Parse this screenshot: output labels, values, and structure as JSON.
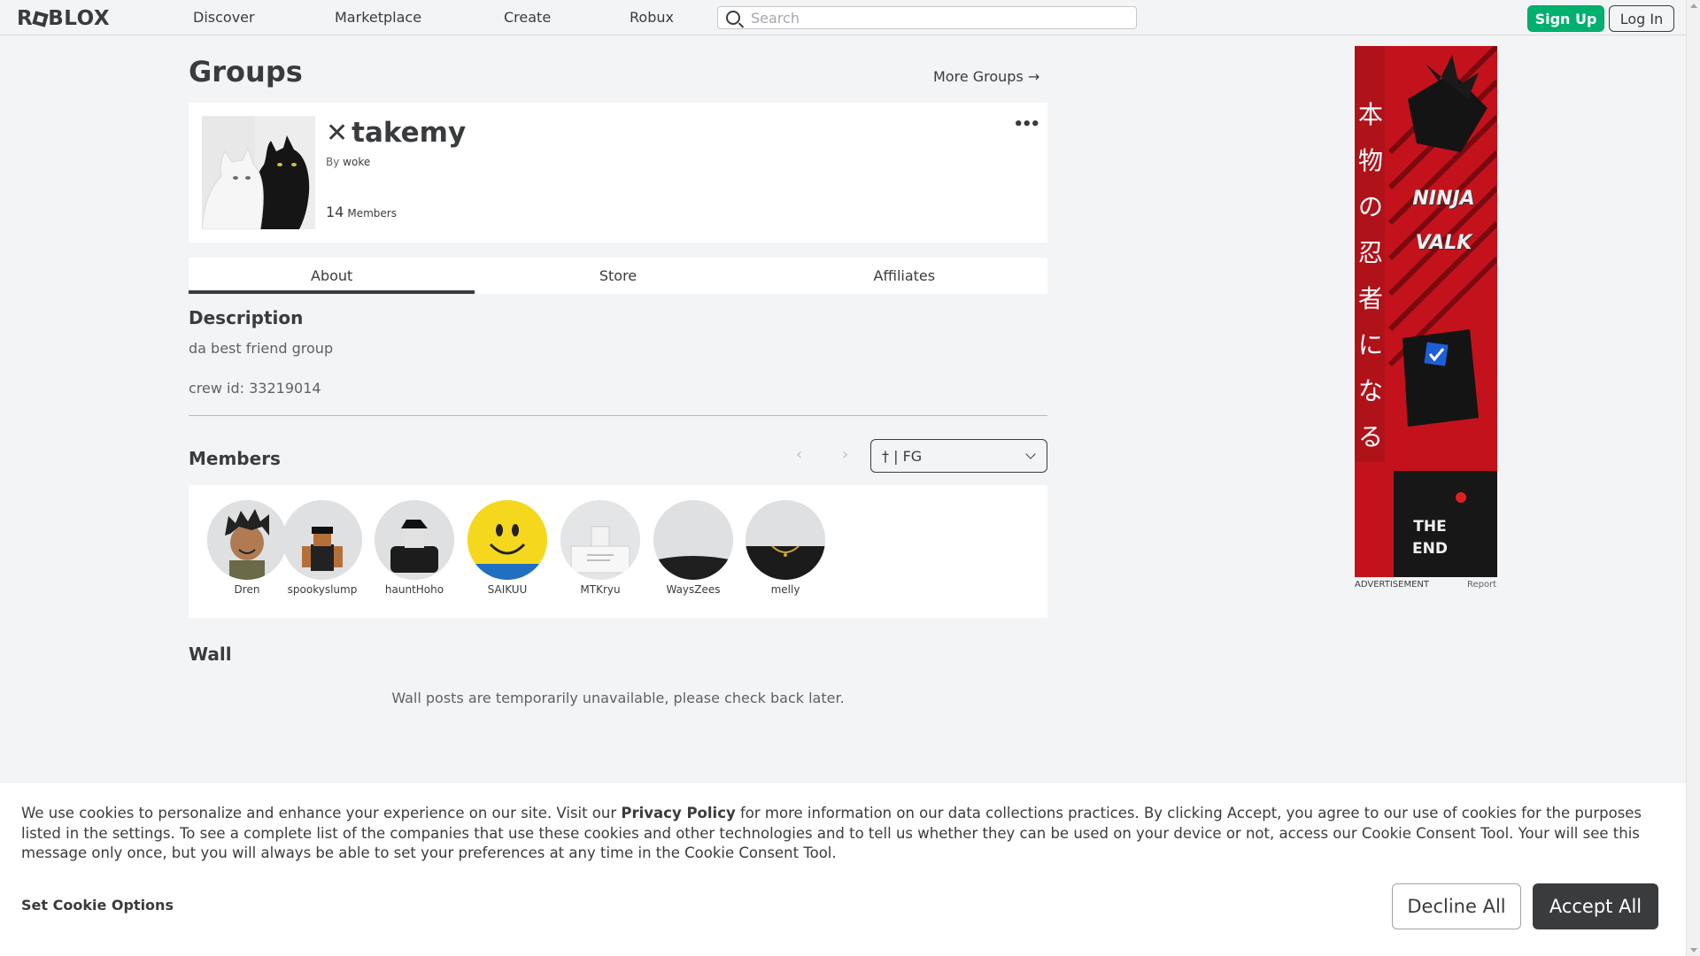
{
  "nav": {
    "logo": "ROBLOX",
    "links": [
      "Discover",
      "Marketplace",
      "Create",
      "Robux"
    ],
    "search_placeholder": "Search",
    "signup_label": "Sign Up",
    "login_label": "Log In"
  },
  "page": {
    "title": "Groups",
    "more_groups": "More Groups →"
  },
  "group": {
    "name": "takemy",
    "name_prefix_icon": "x-icon",
    "by_label": "By",
    "owner": "woke",
    "member_count": "14",
    "members_label": "Members",
    "more_options_icon": "ellipsis-icon"
  },
  "tabs": [
    {
      "label": "About",
      "active": true
    },
    {
      "label": "Store",
      "active": false
    },
    {
      "label": "Affiliates",
      "active": false
    }
  ],
  "about": {
    "description_heading": "Description",
    "description_lines": [
      "da best friend group",
      "crew id: 33219014"
    ]
  },
  "members_section": {
    "heading": "Members",
    "role_filter": "† | FG",
    "members": [
      {
        "name": "Dren"
      },
      {
        "name": "spookyslump"
      },
      {
        "name": "hauntHoho"
      },
      {
        "name": "SAIKUU"
      },
      {
        "name": "MTKryu"
      },
      {
        "name": "WaysZees"
      },
      {
        "name": "melly"
      }
    ]
  },
  "wall": {
    "heading": "Wall",
    "notice": "Wall posts are temporarily unavailable, please check back later."
  },
  "ad": {
    "label": "ADVERTISEMENT",
    "report": "Report",
    "vertical_text": "本物の忍者になる",
    "brand_text": [
      "NINJA",
      "VALK"
    ],
    "end_text": [
      "THE",
      "END"
    ]
  },
  "cookie": {
    "text_before": "We use cookies to personalize and enhance your experience on our site. Visit our ",
    "privacy_link": "Privacy Policy",
    "text_after": " for more information on our data collections practices. By clicking Accept, you agree to our use of cookies for the purposes listed in the settings. To see a complete list of the companies that use these cookies and other technologies and to tell us whether they can be used on your device or not, access our Cookie Consent Tool. Your will see this message only once, but you will always be able to set your preferences at any time in the Cookie Consent Tool.",
    "options_label": "Set Cookie Options",
    "decline_label": "Decline All",
    "accept_label": "Accept All"
  },
  "colors": {
    "accent_green": "#00b06f",
    "text_dark": "#393b3d",
    "background": "#f2f4f5"
  }
}
